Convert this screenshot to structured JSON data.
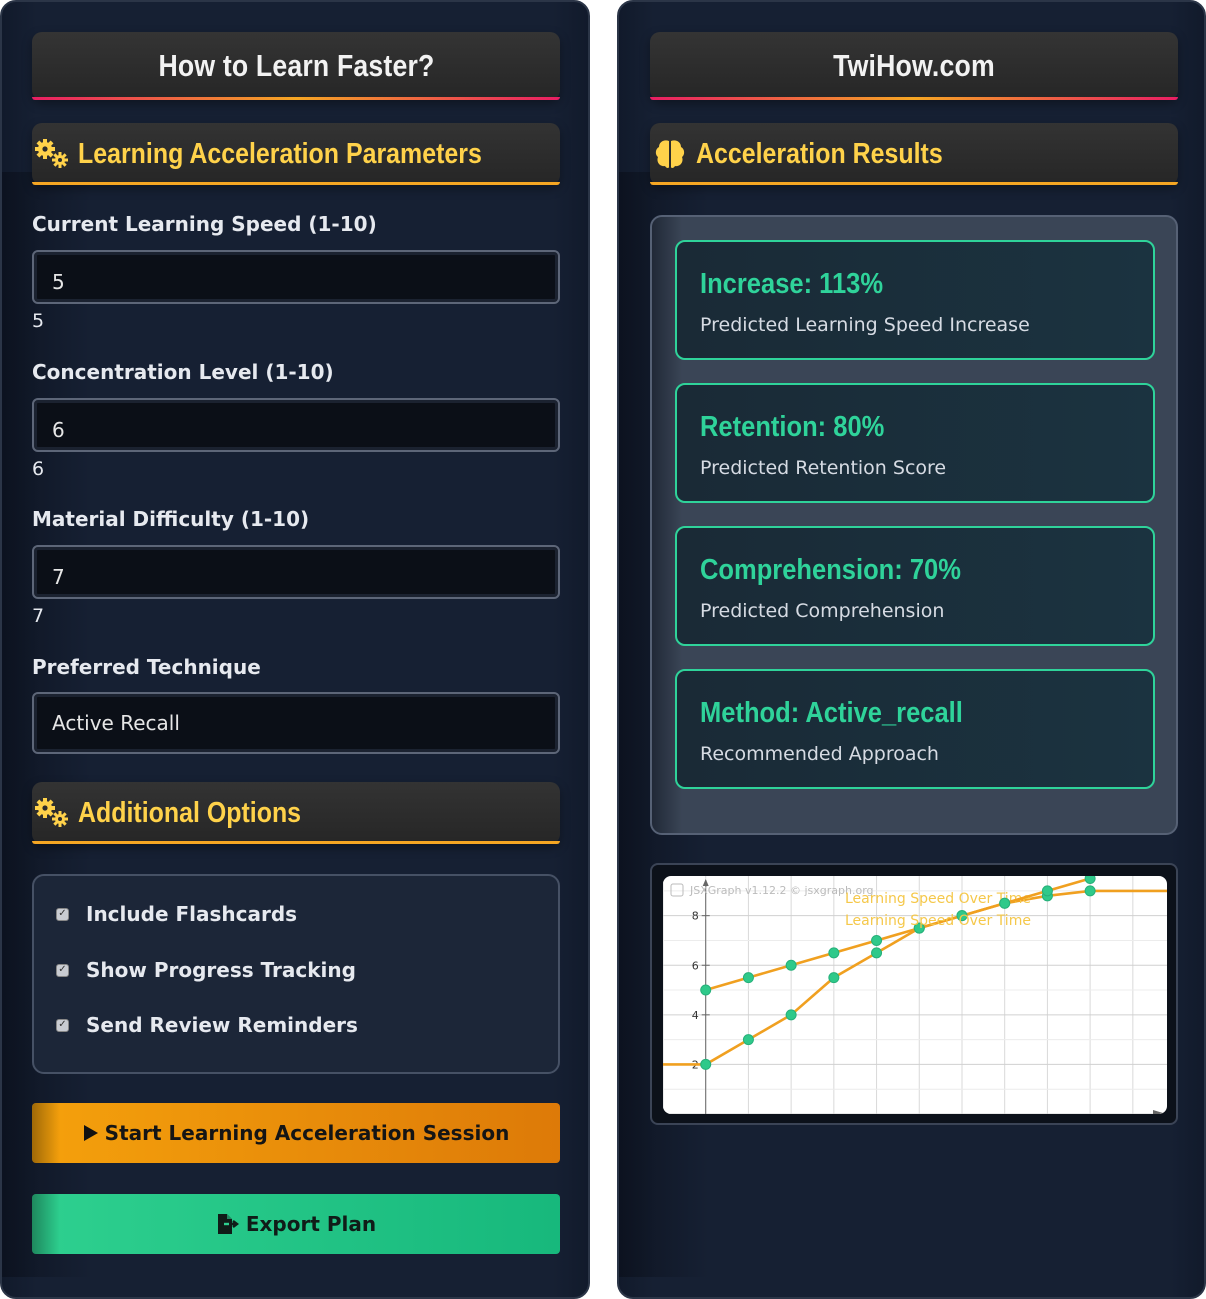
{
  "left": {
    "title": "How to Learn Faster?",
    "params_heading": "Learning Acceleration Parameters",
    "fields": [
      {
        "label": "Current Learning Speed (1-10)",
        "value": "5",
        "display": "5"
      },
      {
        "label": "Concentration Level (1-10)",
        "value": "6",
        "display": "6"
      },
      {
        "label": "Material Difficulty (1-10)",
        "value": "7",
        "display": "7"
      }
    ],
    "technique": {
      "label": "Preferred Technique",
      "value": "Active Recall"
    },
    "options_heading": "Additional Options",
    "options": [
      {
        "label": "Include Flashcards",
        "checked": true
      },
      {
        "label": "Show Progress Tracking",
        "checked": true
      },
      {
        "label": "Send Review Reminders",
        "checked": true
      }
    ],
    "start_button": "Start Learning Acceleration Session",
    "export_button": "Export Plan"
  },
  "right": {
    "title": "TwiHow.com",
    "results_heading": "Acceleration Results",
    "results": [
      {
        "title": "Increase: 113%",
        "subtitle": "Predicted Learning Speed Increase"
      },
      {
        "title": "Retention: 80%",
        "subtitle": "Predicted Retention Score"
      },
      {
        "title": "Comprehension: 70%",
        "subtitle": "Predicted Comprehension"
      },
      {
        "title": "Method: Active_recall",
        "subtitle": "Recommended Approach"
      }
    ]
  },
  "colors": {
    "accent_gold": "#ffd24a",
    "accent_orange": "#f5a10c",
    "accent_green": "#2fd39a",
    "line_color": "#f0a020",
    "point_color": "#2fc98a"
  },
  "chart_data": {
    "type": "line",
    "watermark": "JSXGraph v1.12.2 © jsxgraph.org",
    "xlim": [
      -1,
      10.8
    ],
    "ylim": [
      0,
      9.6
    ],
    "yticks": [
      2,
      4,
      6,
      8
    ],
    "grid": true,
    "series": [
      {
        "name": "Learning Speed Over Time",
        "x": [
          0,
          1,
          2,
          3,
          4,
          5,
          6,
          7,
          8,
          9
        ],
        "y": [
          5,
          5.5,
          6,
          6.5,
          7,
          7.5,
          8,
          8.5,
          8.8,
          9
        ]
      },
      {
        "name": "Learning Speed Over Time",
        "x": [
          0,
          1,
          2,
          3,
          4,
          5,
          6,
          7,
          8,
          9
        ],
        "y": [
          2,
          3,
          4,
          5.5,
          6.5,
          7.5,
          8,
          8.5,
          9,
          9.5
        ]
      }
    ]
  }
}
